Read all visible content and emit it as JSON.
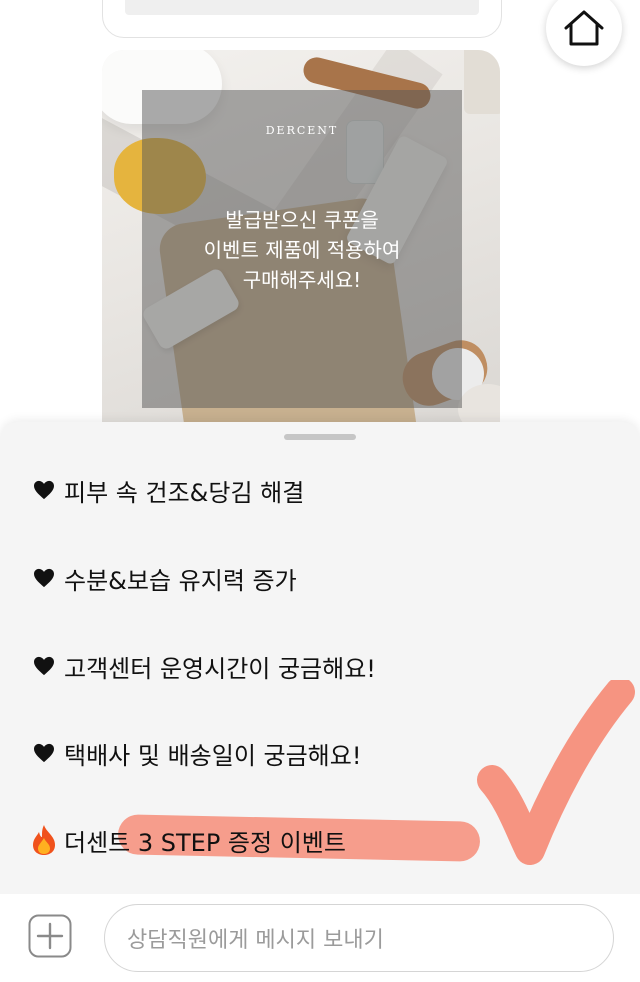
{
  "banner": {
    "brand": "DERCENT",
    "message_lines": [
      "발급받으신 쿠폰을",
      "이벤트 제품에 적용하여",
      "구매해주세요!"
    ]
  },
  "options": [
    {
      "icon": "black-heart-icon",
      "label": "피부 속 건조&당김 해결"
    },
    {
      "icon": "black-heart-icon",
      "label": "수분&보습 유지력 증가"
    },
    {
      "icon": "black-heart-icon",
      "label": "고객센터 운영시간이 궁금해요!"
    },
    {
      "icon": "black-heart-icon",
      "label": "택배사 및 배송일이 궁금해요!"
    },
    {
      "icon": "fire-icon",
      "label": "더센트 3 STEP 증정 이벤트"
    }
  ],
  "composer": {
    "placeholder": "상담직원에게 메시지 보내기"
  },
  "colors": {
    "highlight": "#f67860",
    "sheet_bg": "#f5f5f5",
    "text": "#111111",
    "placeholder": "#9b9b9b"
  }
}
